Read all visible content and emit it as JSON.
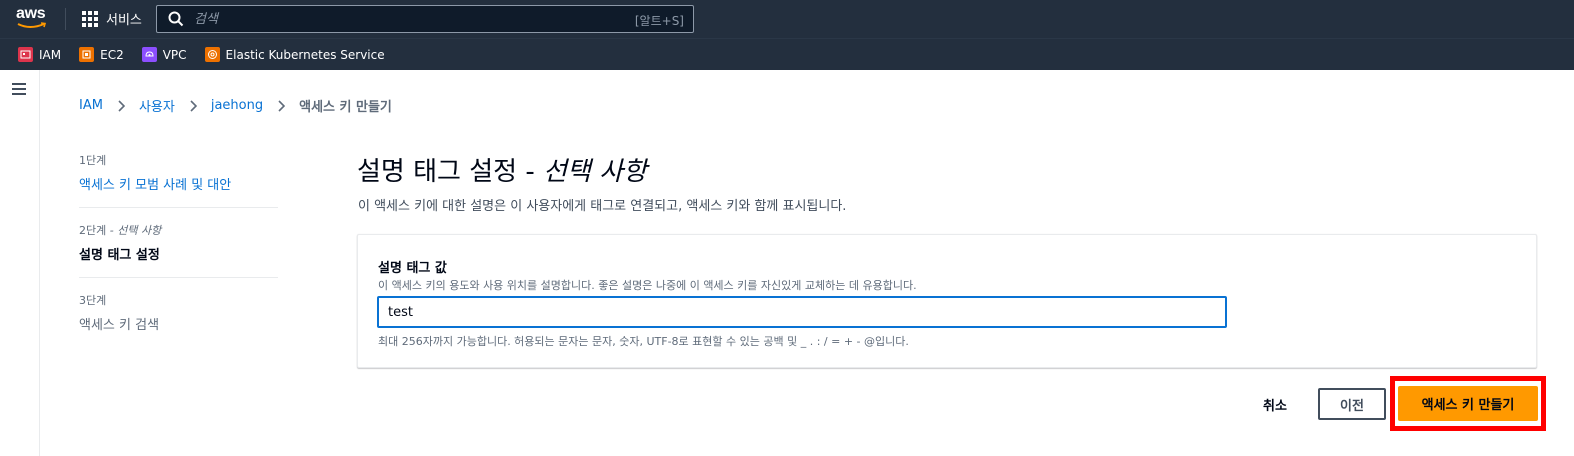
{
  "topnav": {
    "logo_text": "aws",
    "services_label": "서비스",
    "search_placeholder": "검색",
    "search_shortcut": "[알트+S]"
  },
  "favorites": [
    {
      "label": "IAM",
      "icon": "iam-icon",
      "color": "#dd344c"
    },
    {
      "label": "EC2",
      "icon": "ec2-icon",
      "color": "#ed7100"
    },
    {
      "label": "VPC",
      "icon": "vpc-icon",
      "color": "#8c4fff"
    },
    {
      "label": "Elastic Kubernetes Service",
      "icon": "eks-icon",
      "color": "#ed7100"
    }
  ],
  "breadcrumb": {
    "items": [
      "IAM",
      "사용자",
      "jaehong"
    ],
    "current": "액세스 키 만들기"
  },
  "wizard": {
    "steps": [
      {
        "num": "1단계",
        "num_suffix": "",
        "title": "액세스 키 모범 사례 및 대안"
      },
      {
        "num": "2단계",
        "num_suffix": " - 선택 사항",
        "title": "설명 태그 설정"
      },
      {
        "num": "3단계",
        "num_suffix": "",
        "title": "액세스 키 검색"
      }
    ]
  },
  "main": {
    "title": "설명 태그 설정",
    "title_suffix": "선택 사항",
    "description": "이 액세스 키에 대한 설명은 이 사용자에게 태그로 연결되고, 액세스 키와 함께 표시됩니다.",
    "field": {
      "label": "설명 태그 값",
      "description": "이 액세스 키의 용도와 사용 위치를 설명합니다. 좋은 설명은 나중에 이 액세스 키를 자신있게 교체하는 데 유용합니다.",
      "value": "test",
      "constraint": "최대 256자까지 가능합니다. 허용되는 문자는 문자, 숫자, UTF-8로 표현할 수 있는 공백 및 _ . : / = + - @입니다."
    }
  },
  "actions": {
    "cancel": "취소",
    "previous": "이전",
    "create": "액세스 키 만들기"
  },
  "colors": {
    "nav_bg": "#232f3e",
    "link": "#0972d3",
    "primary_button": "#ff9900",
    "highlight": "#ff0000"
  }
}
